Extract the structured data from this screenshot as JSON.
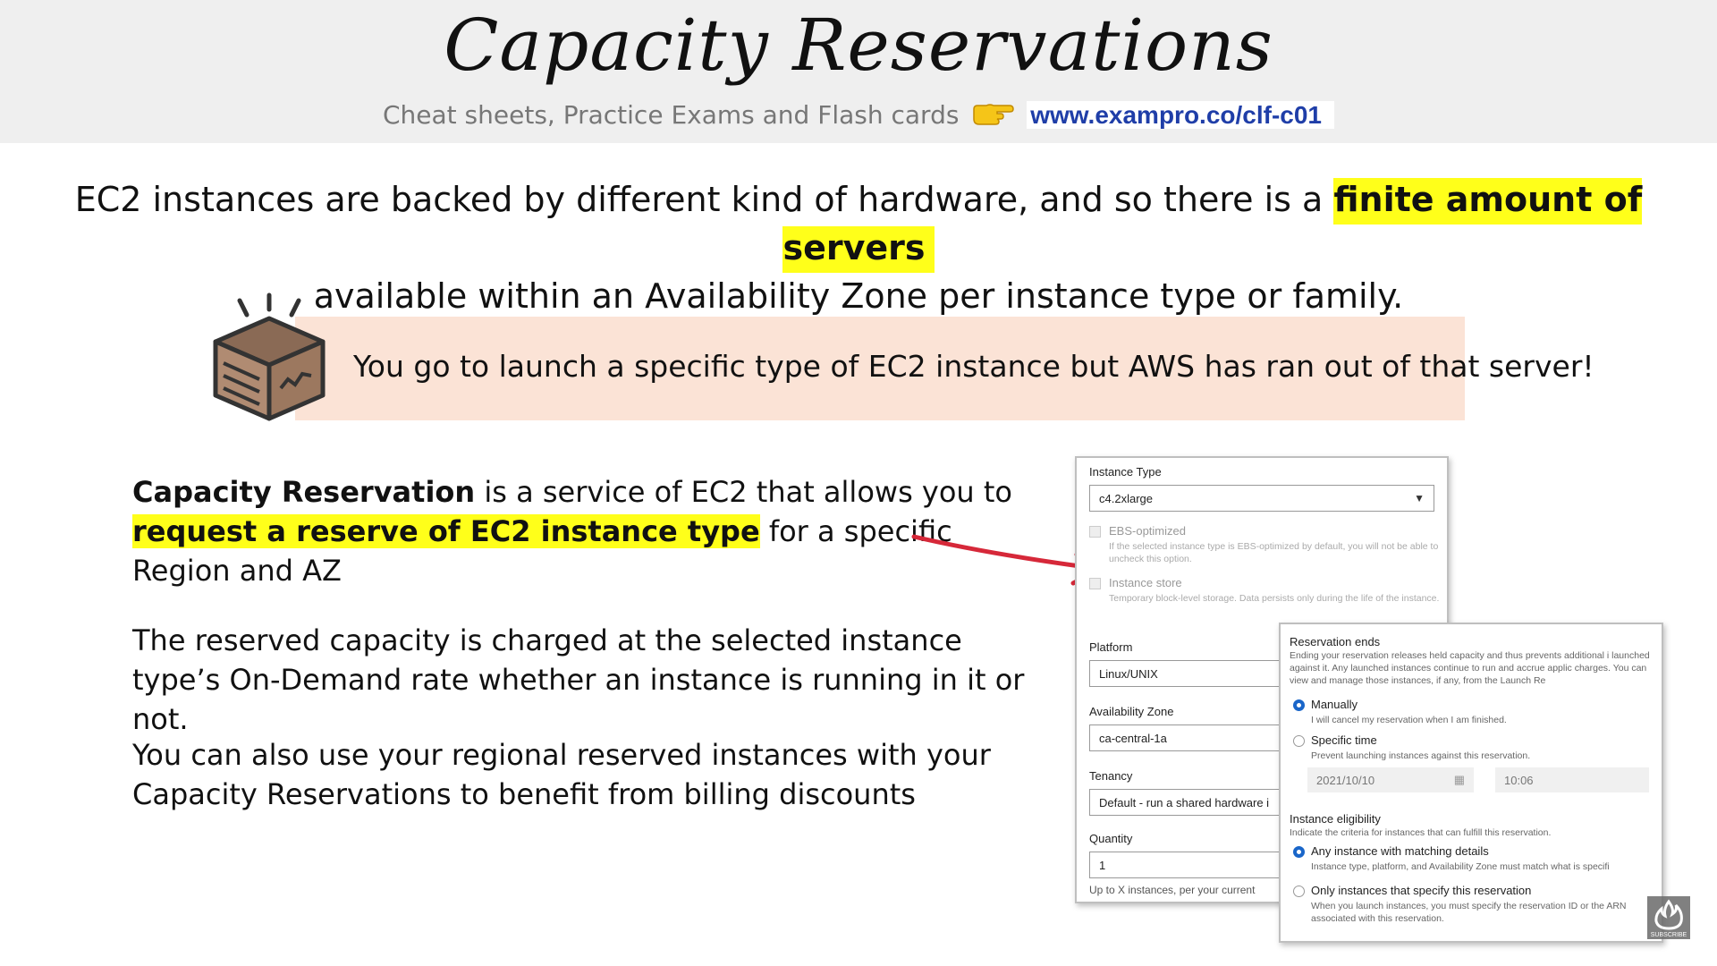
{
  "header": {
    "title": "Capacity Reservations",
    "subtitle": "Cheat sheets, Practice Exams and Flash cards",
    "link": "www.exampro.co/clf-c01"
  },
  "intro": {
    "part1": "EC2 instances are backed by different kind of hardware, and so there is a ",
    "highlight": "finite amount of servers",
    "part2": "available within an Availability Zone per instance type or family."
  },
  "callout": {
    "text": "You go to launch a specific type of EC2 instance but AWS has ran out of that server!"
  },
  "body": {
    "p1_bold": "Capacity Reservation",
    "p1_mid": " is a service of EC2 that allows you to ",
    "p1_highlight": "request a reserve of EC2 instance type",
    "p1_end": " for a specific Region and AZ",
    "p2": "The reserved capacity is charged at the selected instance type’s On-Demand rate whether an instance is running in it or not.",
    "p3": "You can also use your regional reserved instances with your Capacity Reservations to benefit from billing discounts"
  },
  "form": {
    "instance_type_label": "Instance Type",
    "instance_type_value": "c4.2xlarge",
    "ebs_label": "EBS-optimized",
    "ebs_desc": "If the selected instance type is EBS-optimized by default, you will not be able to uncheck this option.",
    "store_label": "Instance store",
    "store_desc": "Temporary block-level storage. Data persists only during the life of the instance.",
    "platform_label": "Platform",
    "platform_value": "Linux/UNIX",
    "az_label": "Availability Zone",
    "az_value": "ca-central-1a",
    "tenancy_label": "Tenancy",
    "tenancy_value": "Default - run a shared hardware i",
    "quantity_label": "Quantity",
    "quantity_value": "1",
    "quantity_help": "Up to X instances, per your current"
  },
  "reservation": {
    "ends_label": "Reservation ends",
    "ends_desc": "Ending your reservation releases held capacity and thus prevents additional i launched against it. Any launched instances continue to run and accrue applic charges. You can view and manage those instances, if any, from the Launch Re",
    "manually_label": "Manually",
    "manually_desc": "I will cancel my reservation when I am finished.",
    "specific_label": "Specific time",
    "specific_desc": "Prevent launching instances against this reservation.",
    "date_value": "2021/10/10",
    "time_value": "10:06",
    "eligibility_label": "Instance eligibility",
    "eligibility_desc": "Indicate the criteria for instances that can fulfill this reservation.",
    "any_label": "Any instance with matching details",
    "any_desc": "Instance type, platform, and Availability Zone must match what is specifi",
    "only_label": "Only instances that specify this reservation",
    "only_desc": "When you launch instances, you must specify the reservation ID or the ARN associated with this reservation."
  },
  "badge": {
    "text": "SUBSCRIBE"
  },
  "colors": {
    "highlight": "#ffff1a",
    "callout_bg": "#fbe3d6",
    "arrow": "#d62839",
    "link": "#1f3ea8"
  }
}
